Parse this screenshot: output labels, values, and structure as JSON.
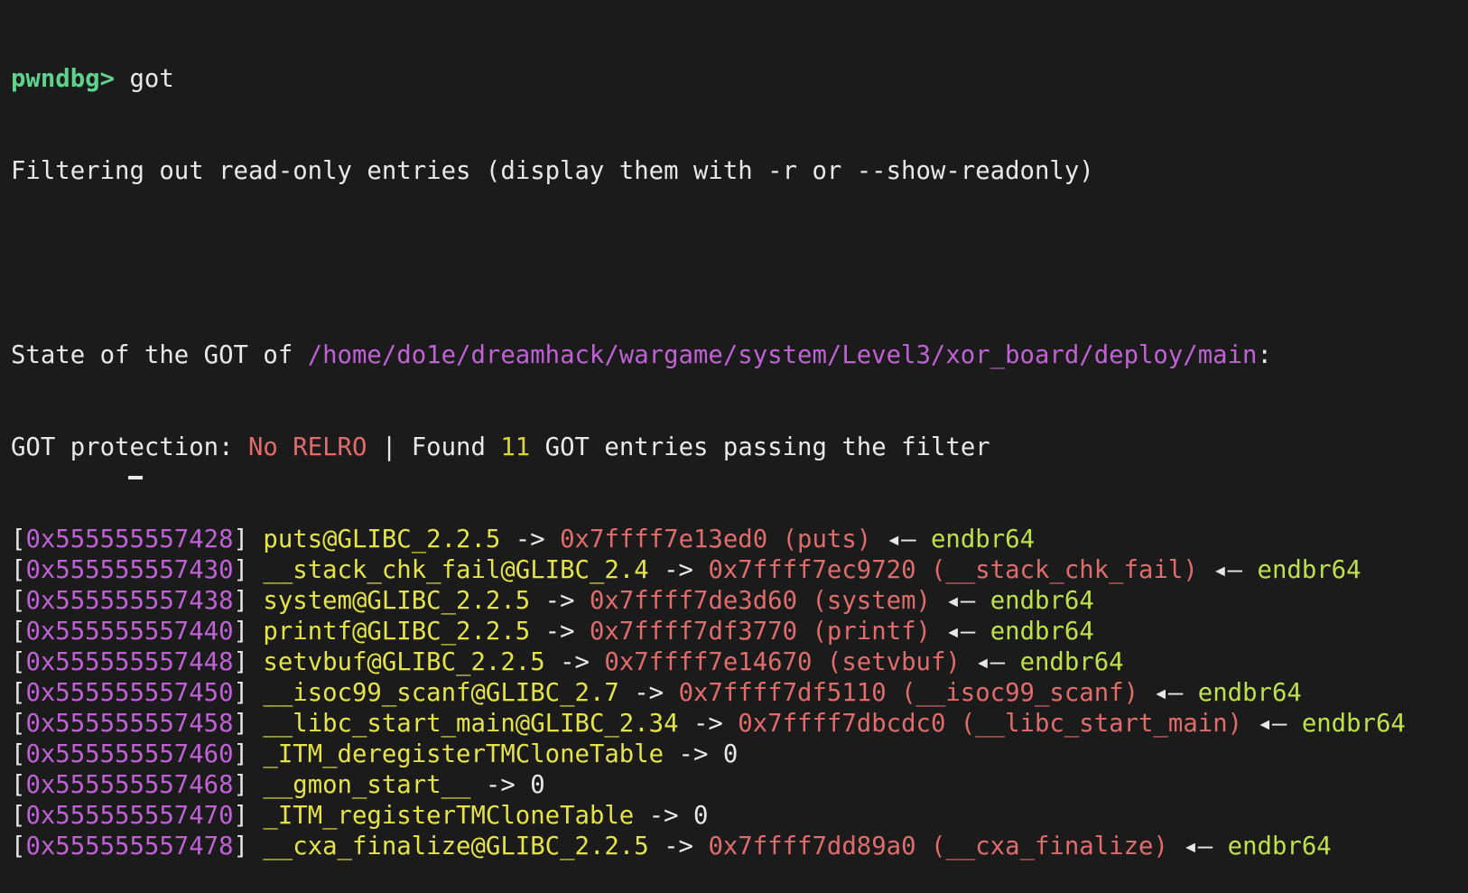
{
  "prompt": {
    "label": "pwndbg>",
    "command": "got"
  },
  "filter_notice": "Filtering out read-only entries (display them with -r or --show-readonly)",
  "state": {
    "prefix": "State of the GOT of",
    "path": "/home/do1e/dreamhack/wargame/system/Level3/xor_board/deploy/main",
    "suffix": ":"
  },
  "protection": {
    "label": "GOT protection:",
    "value": "No RELRO",
    "separator": "|",
    "found_prefix": "Found",
    "count": "11",
    "found_suffix": "GOT entries passing the filter"
  },
  "colors": {
    "prompt": "#5fd38d",
    "address": "#c061d6",
    "symbol": "#e4e44a",
    "target": "#e06c6c",
    "instruction": "#bfe04a",
    "background": "#1b1b1b"
  },
  "entries": [
    {
      "addr": "0x555555557428",
      "symbol": "puts@GLIBC_2.2.5",
      "target": "0x7ffff7e13ed0 (puts)",
      "insn": "endbr64",
      "resolved": true
    },
    {
      "addr": "0x555555557430",
      "symbol": "__stack_chk_fail@GLIBC_2.4",
      "target": "0x7ffff7ec9720 (__stack_chk_fail)",
      "insn": "endbr64",
      "resolved": true
    },
    {
      "addr": "0x555555557438",
      "symbol": "system@GLIBC_2.2.5",
      "target": "0x7ffff7de3d60 (system)",
      "insn": "endbr64",
      "resolved": true
    },
    {
      "addr": "0x555555557440",
      "symbol": "printf@GLIBC_2.2.5",
      "target": "0x7ffff7df3770 (printf)",
      "insn": "endbr64",
      "resolved": true
    },
    {
      "addr": "0x555555557448",
      "symbol": "setvbuf@GLIBC_2.2.5",
      "target": "0x7ffff7e14670 (setvbuf)",
      "insn": "endbr64",
      "resolved": true
    },
    {
      "addr": "0x555555557450",
      "symbol": "__isoc99_scanf@GLIBC_2.7",
      "target": "0x7ffff7df5110 (__isoc99_scanf)",
      "insn": "endbr64",
      "resolved": true
    },
    {
      "addr": "0x555555557458",
      "symbol": "__libc_start_main@GLIBC_2.34",
      "target": "0x7ffff7dbcdc0 (__libc_start_main)",
      "insn": "endbr64",
      "resolved": true
    },
    {
      "addr": "0x555555557460",
      "symbol": "_ITM_deregisterTMCloneTable",
      "target": "0",
      "insn": "",
      "resolved": false
    },
    {
      "addr": "0x555555557468",
      "symbol": "__gmon_start__",
      "target": "0",
      "insn": "",
      "resolved": false
    },
    {
      "addr": "0x555555557470",
      "symbol": "_ITM_registerTMCloneTable",
      "target": "0",
      "insn": "",
      "resolved": false
    },
    {
      "addr": "0x555555557478",
      "symbol": "__cxa_finalize@GLIBC_2.2.5",
      "target": "0x7ffff7dd89a0 (__cxa_finalize)",
      "insn": "endbr64",
      "resolved": true
    }
  ],
  "glyphs": {
    "arrow": "->",
    "back_arrow": "◂—"
  }
}
